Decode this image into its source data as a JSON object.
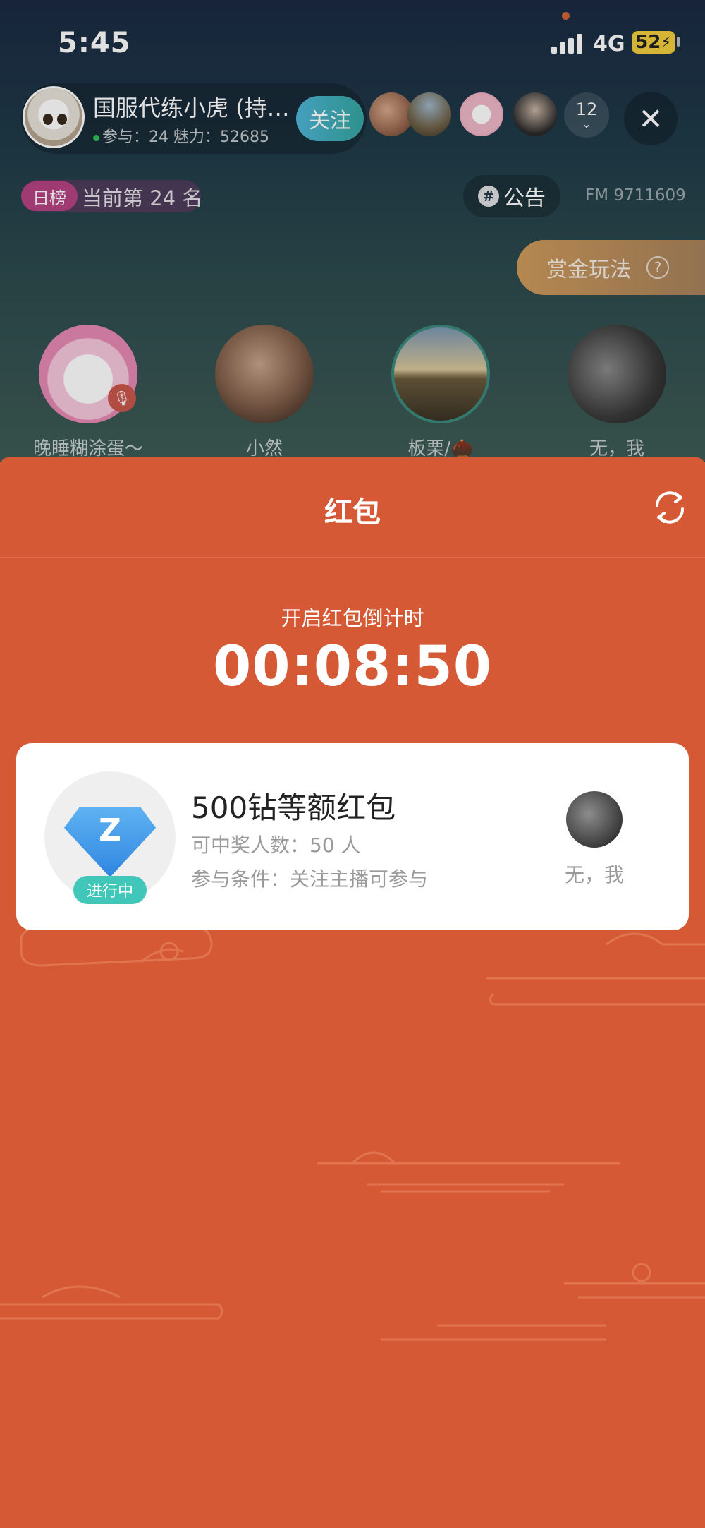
{
  "status_bar": {
    "time": "5:45",
    "network": "4G",
    "battery": "52"
  },
  "room": {
    "host": {
      "name": "国服代练小虎 (持…",
      "stats": "参与：24 魅力：52685"
    },
    "follow_label": "关注",
    "viewer_count": "12",
    "rank": {
      "tag": "日榜",
      "text": "当前第 24 名"
    },
    "notice_label": "公告",
    "fm": "FM 9711609",
    "bounty_label": "赏金玩法",
    "seats": [
      {
        "name": "晚睡糊涂蛋～"
      },
      {
        "name": "小然"
      },
      {
        "name": "板栗/🌰"
      },
      {
        "name": "无，我"
      }
    ]
  },
  "panel": {
    "title": "红包",
    "countdown_label": "开启红包倒计时",
    "countdown_time": "00:08:50",
    "packet": {
      "icon_letter": "Z",
      "status": "进行中",
      "title": "500钻等额红包",
      "winners": "可中奖人数：50 人",
      "condition": "参与条件：关注主播可参与",
      "sender_name": "无，我"
    }
  },
  "colors": {
    "panel_bg": "#d65935",
    "status_badge": "#41c6ba",
    "follow_btn": "#3faec0",
    "rank_tag": "#b64383"
  }
}
